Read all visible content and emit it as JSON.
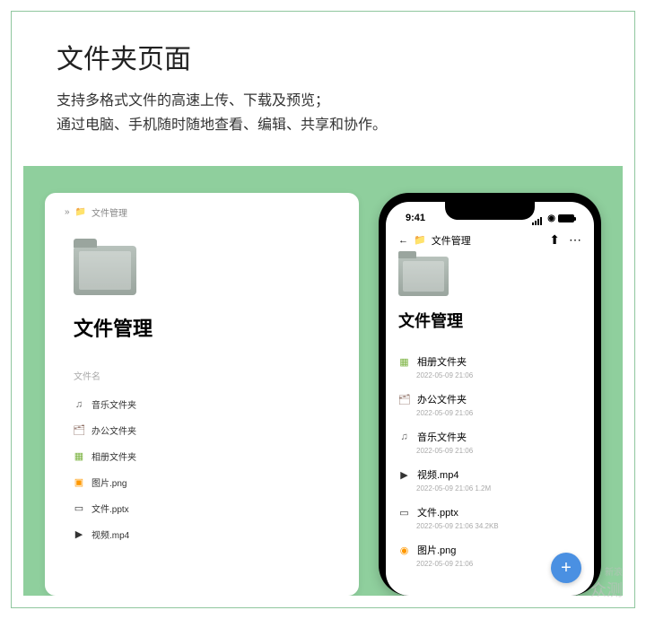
{
  "header": {
    "title": "文件夹页面",
    "subtitle_line1": "支持多格式文件的高速上传、下载及预览；",
    "subtitle_line2": "通过电脑、手机随时随地查看、编辑、共享和协作。"
  },
  "desktop": {
    "breadcrumb_arrows": "»",
    "breadcrumb_label": "文件管理",
    "title": "文件管理",
    "column_header": "文件名",
    "items": [
      {
        "icon": "♫",
        "icon_class": "ic-music",
        "name": "音乐文件夹"
      },
      {
        "icon": "🗂",
        "icon_class": "ic-office",
        "name": "办公文件夹"
      },
      {
        "icon": "▦",
        "icon_class": "ic-album",
        "name": "相册文件夹"
      },
      {
        "icon": "▣",
        "icon_class": "ic-image",
        "name": "图片.png"
      },
      {
        "icon": "▭",
        "icon_class": "ic-file",
        "name": "文件.pptx"
      },
      {
        "icon": "▶",
        "icon_class": "ic-video",
        "name": "视频.mp4"
      }
    ]
  },
  "phone": {
    "status_time": "9:41",
    "back_icon": "←",
    "breadcrumb_label": "文件管理",
    "share_icon": "⬆",
    "more_icon": "⋯",
    "title": "文件管理",
    "items": [
      {
        "icon": "▦",
        "icon_class": "ic-album",
        "name": "相册文件夹",
        "meta": "2022-05-09 21:06"
      },
      {
        "icon": "🗂",
        "icon_class": "ic-office",
        "name": "办公文件夹",
        "meta": "2022-05-09 21:06"
      },
      {
        "icon": "♫",
        "icon_class": "ic-music",
        "name": "音乐文件夹",
        "meta": "2022-05-09 21:06"
      },
      {
        "icon": "▶",
        "icon_class": "ic-video",
        "name": "视频.mp4",
        "meta": "2022-05-09 21:06    1.2M"
      },
      {
        "icon": "▭",
        "icon_class": "ic-file",
        "name": "文件.pptx",
        "meta": "2022-05-09 21:06    34.2KB"
      },
      {
        "icon": "◉",
        "icon_class": "ic-image",
        "name": "图片.png",
        "meta": "2022-05-09 21:06"
      }
    ],
    "fab_icon": "+"
  },
  "watermark": {
    "brand": "新浪",
    "product": "众测"
  }
}
